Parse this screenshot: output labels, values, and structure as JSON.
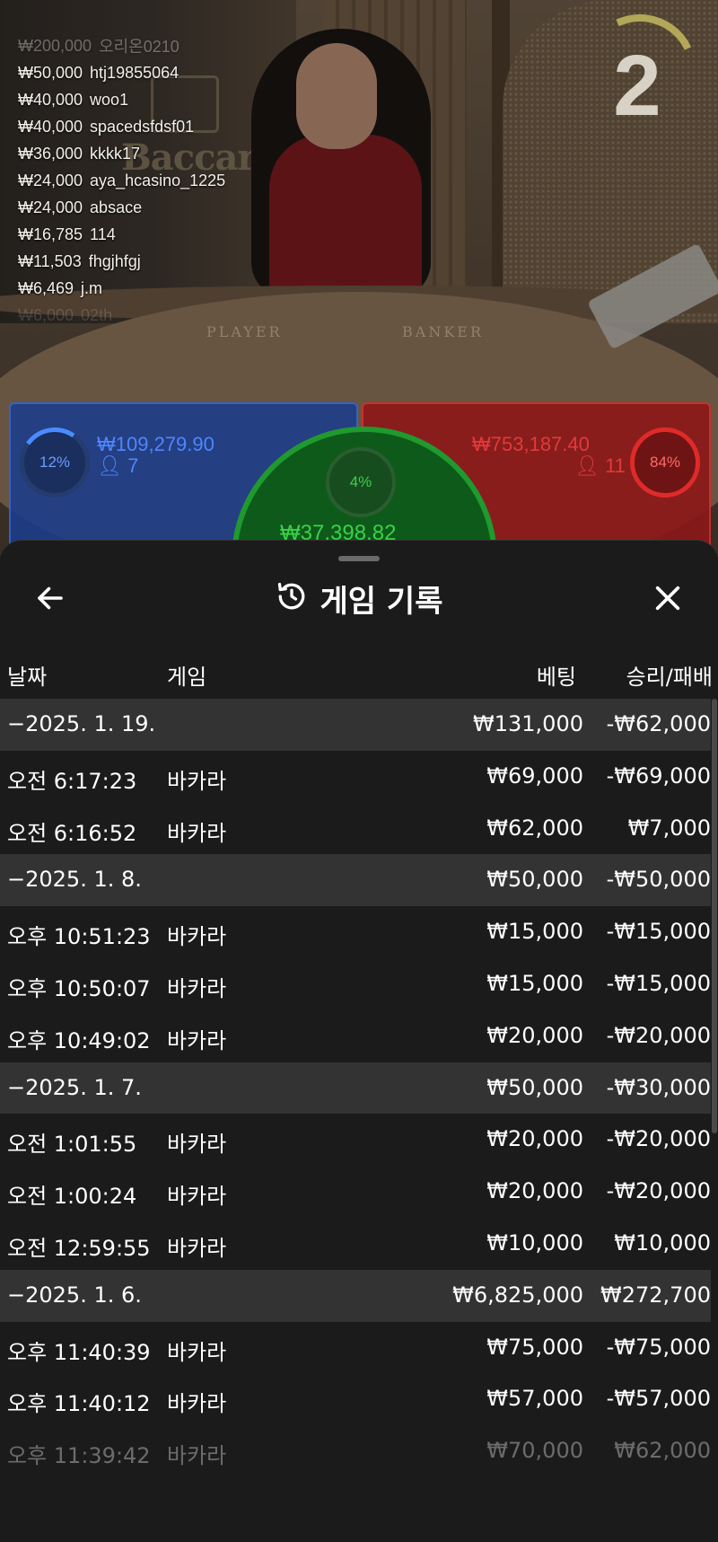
{
  "video": {
    "countdown": "2",
    "table_labels": {
      "player": "PLAYER",
      "banker": "BANKER"
    },
    "logo_text": "Baccarat"
  },
  "chat": [
    {
      "amount": "₩200,000",
      "user": "오리온0210",
      "style": "fade"
    },
    {
      "amount": "₩50,000",
      "user": "htj19855064",
      "style": ""
    },
    {
      "amount": "₩40,000",
      "user": "woo1",
      "style": ""
    },
    {
      "amount": "₩40,000",
      "user": "spacedsfdsf01",
      "style": ""
    },
    {
      "amount": "₩36,000",
      "user": "kkkk17",
      "style": ""
    },
    {
      "amount": "₩24,000",
      "user": "aya_hcasino_1225",
      "style": ""
    },
    {
      "amount": "₩24,000",
      "user": "absace",
      "style": ""
    },
    {
      "amount": "₩16,785",
      "user": "114",
      "style": ""
    },
    {
      "amount": "₩11,503",
      "user": "fhgjhfgj",
      "style": ""
    },
    {
      "amount": "₩6,469",
      "user": "j.m",
      "style": ""
    },
    {
      "amount": "₩6,000",
      "user": "02th",
      "style": "faint"
    }
  ],
  "bets": {
    "player": {
      "percent": "12%",
      "amount": "₩109,279.90",
      "players": "7",
      "color": "#4f86ff"
    },
    "tie": {
      "percent": "4%",
      "amount": "₩37,398.82",
      "color": "#3bd04a"
    },
    "banker": {
      "percent": "84%",
      "amount": "₩753,187.40",
      "players": "11",
      "color": "#e23a3a"
    }
  },
  "history": {
    "title": "게임 기록",
    "columns": {
      "date": "날짜",
      "game": "게임",
      "bet": "베팅",
      "winloss": "승리/패배"
    },
    "rows": [
      {
        "type": "group",
        "date": "−2025. 1. 19.",
        "game": "",
        "bet": "₩131,000",
        "win": "-₩62,000"
      },
      {
        "type": "item",
        "date": "오전 6:17:23",
        "game": "바카라",
        "bet": "₩69,000",
        "win": "-₩69,000"
      },
      {
        "type": "item",
        "date": "오전 6:16:52",
        "game": "바카라",
        "bet": "₩62,000",
        "win": "₩7,000"
      },
      {
        "type": "group",
        "date": "−2025. 1. 8.",
        "game": "",
        "bet": "₩50,000",
        "win": "-₩50,000"
      },
      {
        "type": "item",
        "date": "오후 10:51:23",
        "game": "바카라",
        "bet": "₩15,000",
        "win": "-₩15,000"
      },
      {
        "type": "item",
        "date": "오후 10:50:07",
        "game": "바카라",
        "bet": "₩15,000",
        "win": "-₩15,000"
      },
      {
        "type": "item",
        "date": "오후 10:49:02",
        "game": "바카라",
        "bet": "₩20,000",
        "win": "-₩20,000"
      },
      {
        "type": "group",
        "date": "−2025. 1. 7.",
        "game": "",
        "bet": "₩50,000",
        "win": "-₩30,000"
      },
      {
        "type": "item",
        "date": "오전 1:01:55",
        "game": "바카라",
        "bet": "₩20,000",
        "win": "-₩20,000"
      },
      {
        "type": "item",
        "date": "오전 1:00:24",
        "game": "바카라",
        "bet": "₩20,000",
        "win": "-₩20,000"
      },
      {
        "type": "item",
        "date": "오전 12:59:55",
        "game": "바카라",
        "bet": "₩10,000",
        "win": "₩10,000"
      },
      {
        "type": "group",
        "date": "−2025. 1. 6.",
        "game": "",
        "bet": "₩6,825,000",
        "win": "₩272,700"
      },
      {
        "type": "item",
        "date": "오후 11:40:39",
        "game": "바카라",
        "bet": "₩75,000",
        "win": "-₩75,000"
      },
      {
        "type": "item",
        "date": "오후 11:40:12",
        "game": "바카라",
        "bet": "₩57,000",
        "win": "-₩57,000"
      },
      {
        "type": "item fade",
        "date": "오후 11:39:42",
        "game": "바카라",
        "bet": "₩70,000",
        "win": "₩62,000"
      }
    ]
  }
}
